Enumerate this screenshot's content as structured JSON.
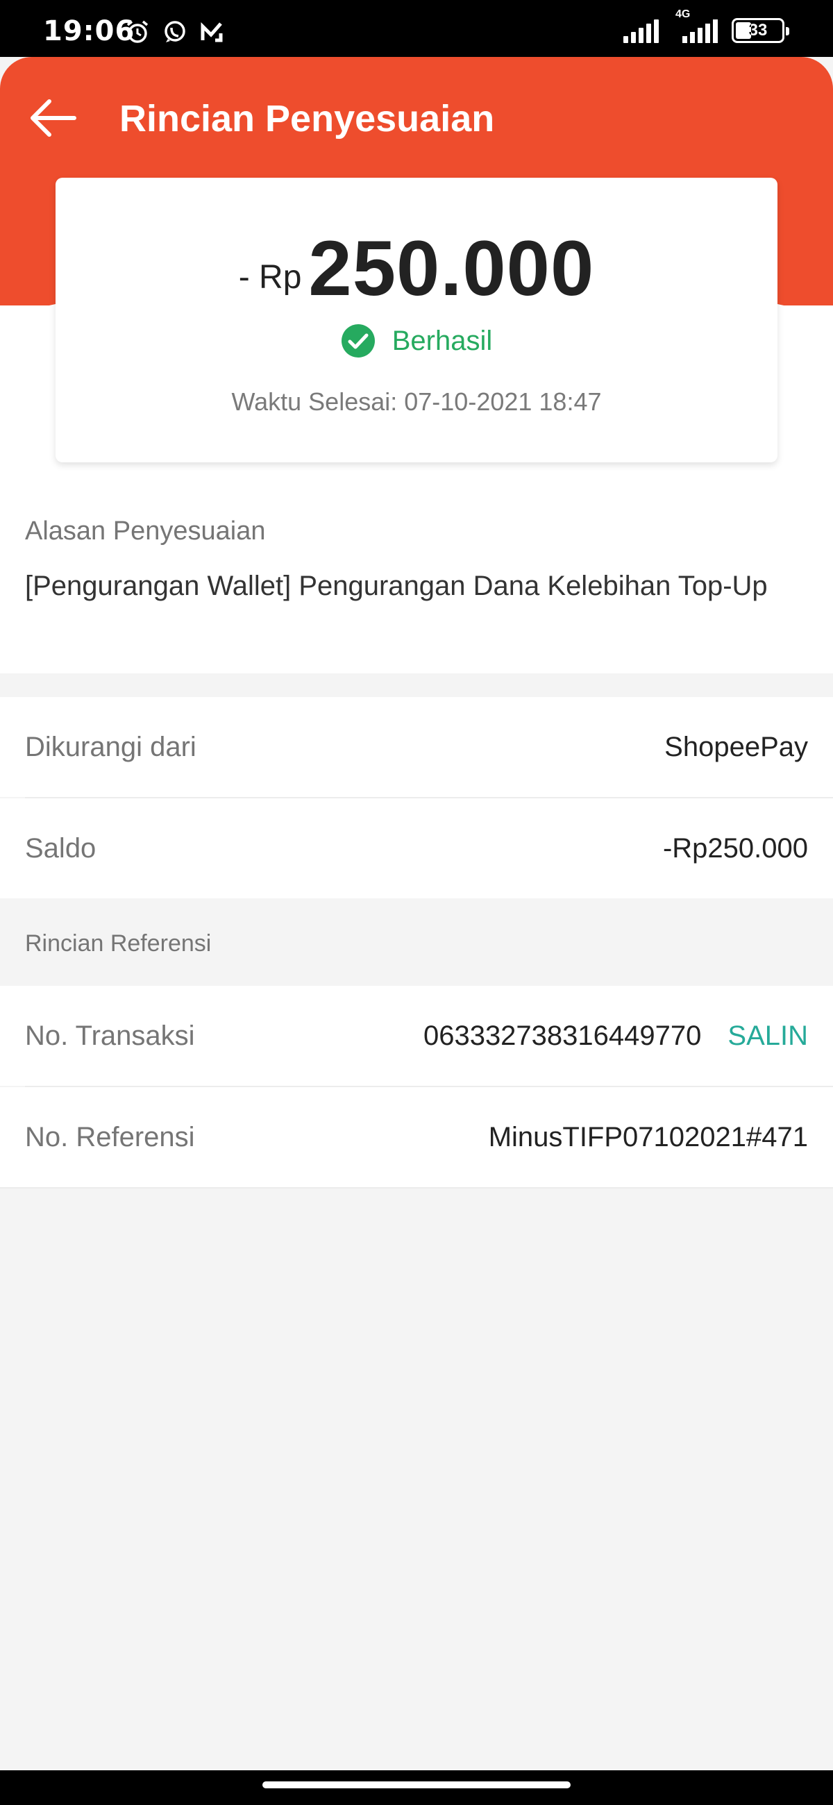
{
  "status_bar": {
    "time": "19:06",
    "network": "4G",
    "battery": "33"
  },
  "header": {
    "title": "Rincian Penyesuaian"
  },
  "summary": {
    "currency_prefix": "- Rp",
    "amount": "250.000",
    "status": "Berhasil",
    "completed_time": "Waktu Selesai: 07-10-2021 18:47"
  },
  "reason": {
    "label": "Alasan Penyesuaian",
    "text": "[Pengurangan Wallet] Pengurangan Dana Kelebihan Top-Up"
  },
  "details": {
    "deducted_from_label": "Dikurangi dari",
    "deducted_from_value": "ShopeePay",
    "balance_label": "Saldo",
    "balance_value": "-Rp250.000"
  },
  "reference": {
    "section_title": "Rincian Referensi",
    "transaction_label": "No. Transaksi",
    "transaction_value": "063332738316449770",
    "copy_label": "SALIN",
    "reference_label": "No. Referensi",
    "reference_value": "MinusTIFP07102021#471"
  },
  "colors": {
    "brand": "#ee4d2d",
    "success": "#26aa5f",
    "copy": "#26aa99"
  }
}
